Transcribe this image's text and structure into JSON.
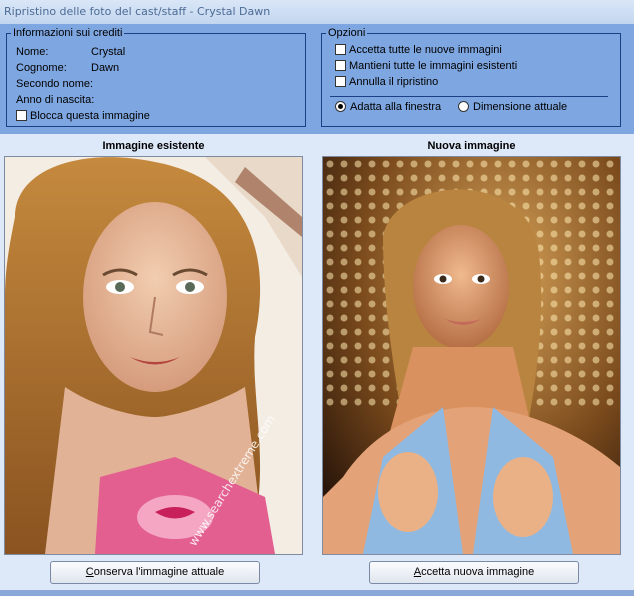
{
  "window": {
    "title": "Ripristino delle foto del cast/staff - Crystal Dawn"
  },
  "credits": {
    "legend": "Informazioni sui crediti",
    "fields": [
      {
        "label": "Nome:",
        "value": "Crystal"
      },
      {
        "label": "Cognome:",
        "value": "Dawn"
      },
      {
        "label": "Secondo nome:",
        "value": ""
      },
      {
        "label": "Anno di nascita:",
        "value": ""
      }
    ],
    "lock_label": "Blocca questa immagine",
    "lock_checked": false
  },
  "options": {
    "legend": "Opzioni",
    "checks": [
      {
        "label": "Accetta tutte le nuove immagini",
        "checked": false
      },
      {
        "label": "Mantieni tutte le immagini esistenti",
        "checked": false
      },
      {
        "label": "Annulla il ripristino",
        "checked": false
      }
    ],
    "radios": [
      {
        "label": "Adatta alla finestra",
        "selected": true
      },
      {
        "label": "Dimensione attuale",
        "selected": false
      }
    ]
  },
  "existing": {
    "title": "Immagine esistente",
    "button_underlined": "C",
    "button_rest": "onserva l'immagine attuale",
    "watermark": "www.searchextreme.com"
  },
  "new_image": {
    "title": "Nuova immagine",
    "button_underlined": "A",
    "button_rest": "ccetta nuova immagine"
  },
  "colors": {
    "panel": "#7ea6e0",
    "group_border": "#1d3f86",
    "main_bg": "#dde8f8"
  }
}
